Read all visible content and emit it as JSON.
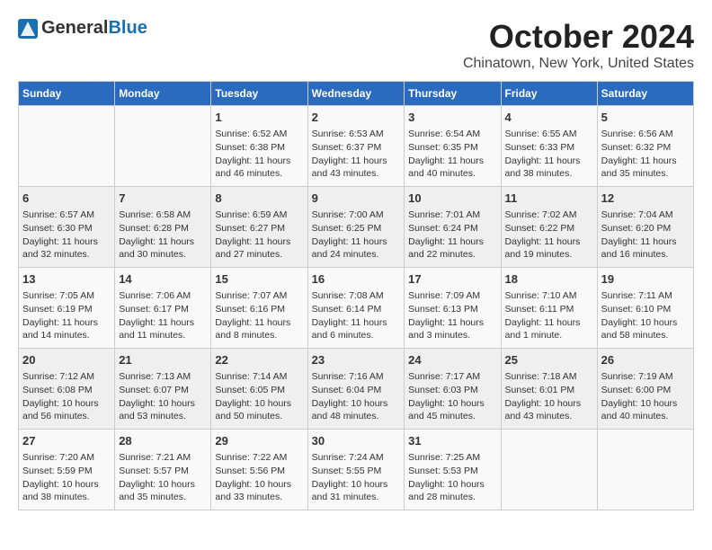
{
  "header": {
    "logo_general": "General",
    "logo_blue": "Blue",
    "month": "October 2024",
    "location": "Chinatown, New York, United States"
  },
  "days_of_week": [
    "Sunday",
    "Monday",
    "Tuesday",
    "Wednesday",
    "Thursday",
    "Friday",
    "Saturday"
  ],
  "weeks": [
    [
      {
        "day": "",
        "content": ""
      },
      {
        "day": "",
        "content": ""
      },
      {
        "day": "1",
        "content": "Sunrise: 6:52 AM\nSunset: 6:38 PM\nDaylight: 11 hours and 46 minutes."
      },
      {
        "day": "2",
        "content": "Sunrise: 6:53 AM\nSunset: 6:37 PM\nDaylight: 11 hours and 43 minutes."
      },
      {
        "day": "3",
        "content": "Sunrise: 6:54 AM\nSunset: 6:35 PM\nDaylight: 11 hours and 40 minutes."
      },
      {
        "day": "4",
        "content": "Sunrise: 6:55 AM\nSunset: 6:33 PM\nDaylight: 11 hours and 38 minutes."
      },
      {
        "day": "5",
        "content": "Sunrise: 6:56 AM\nSunset: 6:32 PM\nDaylight: 11 hours and 35 minutes."
      }
    ],
    [
      {
        "day": "6",
        "content": "Sunrise: 6:57 AM\nSunset: 6:30 PM\nDaylight: 11 hours and 32 minutes."
      },
      {
        "day": "7",
        "content": "Sunrise: 6:58 AM\nSunset: 6:28 PM\nDaylight: 11 hours and 30 minutes."
      },
      {
        "day": "8",
        "content": "Sunrise: 6:59 AM\nSunset: 6:27 PM\nDaylight: 11 hours and 27 minutes."
      },
      {
        "day": "9",
        "content": "Sunrise: 7:00 AM\nSunset: 6:25 PM\nDaylight: 11 hours and 24 minutes."
      },
      {
        "day": "10",
        "content": "Sunrise: 7:01 AM\nSunset: 6:24 PM\nDaylight: 11 hours and 22 minutes."
      },
      {
        "day": "11",
        "content": "Sunrise: 7:02 AM\nSunset: 6:22 PM\nDaylight: 11 hours and 19 minutes."
      },
      {
        "day": "12",
        "content": "Sunrise: 7:04 AM\nSunset: 6:20 PM\nDaylight: 11 hours and 16 minutes."
      }
    ],
    [
      {
        "day": "13",
        "content": "Sunrise: 7:05 AM\nSunset: 6:19 PM\nDaylight: 11 hours and 14 minutes."
      },
      {
        "day": "14",
        "content": "Sunrise: 7:06 AM\nSunset: 6:17 PM\nDaylight: 11 hours and 11 minutes."
      },
      {
        "day": "15",
        "content": "Sunrise: 7:07 AM\nSunset: 6:16 PM\nDaylight: 11 hours and 8 minutes."
      },
      {
        "day": "16",
        "content": "Sunrise: 7:08 AM\nSunset: 6:14 PM\nDaylight: 11 hours and 6 minutes."
      },
      {
        "day": "17",
        "content": "Sunrise: 7:09 AM\nSunset: 6:13 PM\nDaylight: 11 hours and 3 minutes."
      },
      {
        "day": "18",
        "content": "Sunrise: 7:10 AM\nSunset: 6:11 PM\nDaylight: 11 hours and 1 minute."
      },
      {
        "day": "19",
        "content": "Sunrise: 7:11 AM\nSunset: 6:10 PM\nDaylight: 10 hours and 58 minutes."
      }
    ],
    [
      {
        "day": "20",
        "content": "Sunrise: 7:12 AM\nSunset: 6:08 PM\nDaylight: 10 hours and 56 minutes."
      },
      {
        "day": "21",
        "content": "Sunrise: 7:13 AM\nSunset: 6:07 PM\nDaylight: 10 hours and 53 minutes."
      },
      {
        "day": "22",
        "content": "Sunrise: 7:14 AM\nSunset: 6:05 PM\nDaylight: 10 hours and 50 minutes."
      },
      {
        "day": "23",
        "content": "Sunrise: 7:16 AM\nSunset: 6:04 PM\nDaylight: 10 hours and 48 minutes."
      },
      {
        "day": "24",
        "content": "Sunrise: 7:17 AM\nSunset: 6:03 PM\nDaylight: 10 hours and 45 minutes."
      },
      {
        "day": "25",
        "content": "Sunrise: 7:18 AM\nSunset: 6:01 PM\nDaylight: 10 hours and 43 minutes."
      },
      {
        "day": "26",
        "content": "Sunrise: 7:19 AM\nSunset: 6:00 PM\nDaylight: 10 hours and 40 minutes."
      }
    ],
    [
      {
        "day": "27",
        "content": "Sunrise: 7:20 AM\nSunset: 5:59 PM\nDaylight: 10 hours and 38 minutes."
      },
      {
        "day": "28",
        "content": "Sunrise: 7:21 AM\nSunset: 5:57 PM\nDaylight: 10 hours and 35 minutes."
      },
      {
        "day": "29",
        "content": "Sunrise: 7:22 AM\nSunset: 5:56 PM\nDaylight: 10 hours and 33 minutes."
      },
      {
        "day": "30",
        "content": "Sunrise: 7:24 AM\nSunset: 5:55 PM\nDaylight: 10 hours and 31 minutes."
      },
      {
        "day": "31",
        "content": "Sunrise: 7:25 AM\nSunset: 5:53 PM\nDaylight: 10 hours and 28 minutes."
      },
      {
        "day": "",
        "content": ""
      },
      {
        "day": "",
        "content": ""
      }
    ]
  ]
}
